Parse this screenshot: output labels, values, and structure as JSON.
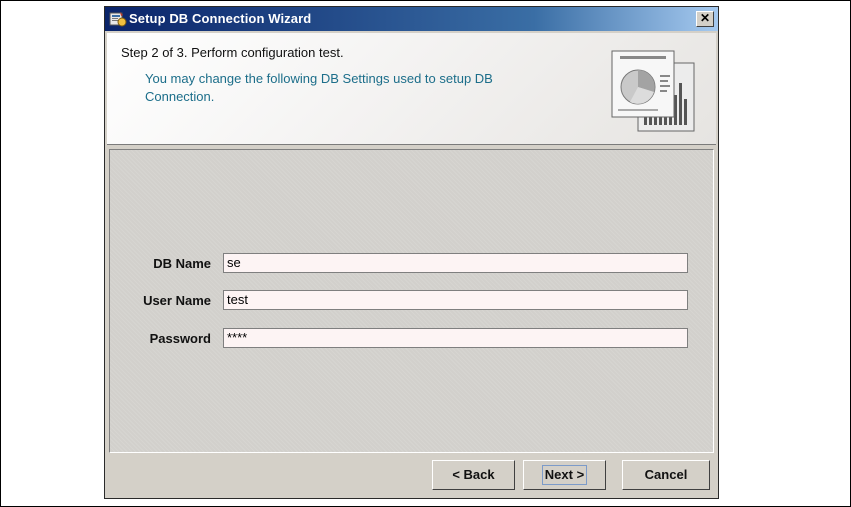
{
  "window": {
    "title": "Setup DB Connection Wizard",
    "close_glyph": "✕",
    "icon": "wizard-app-icon"
  },
  "header": {
    "step": "Step 2 of 3. Perform configuration test.",
    "description": "You may change the following DB Settings used to setup DB Connection.",
    "graphic": "chart-documents-illustration"
  },
  "form": {
    "db_name": {
      "label": "DB Name",
      "value": "se"
    },
    "user_name": {
      "label": "User Name",
      "value": "test"
    },
    "password": {
      "label": "Password",
      "value": "****"
    }
  },
  "buttons": {
    "back": "< Back",
    "next": "Next >",
    "cancel": "Cancel"
  },
  "colors": {
    "titlebar_start": "#0a246a",
    "titlebar_end": "#a6caf0",
    "description_text": "#1c6e8a",
    "field_background": "#fdf4f4",
    "dialog_background": "#d4d0c8"
  }
}
